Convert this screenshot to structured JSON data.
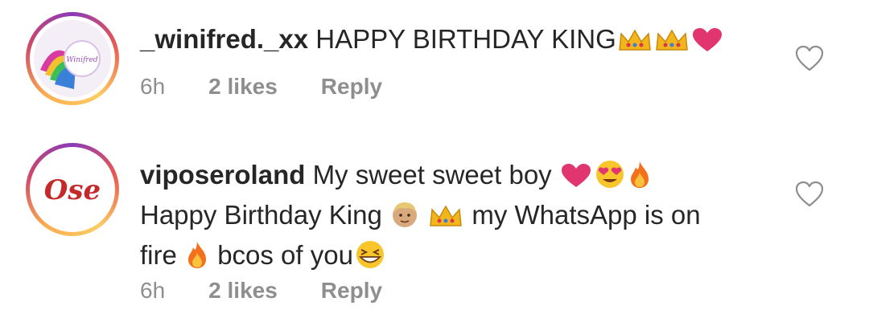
{
  "comments": [
    {
      "username": "_winifred._xx",
      "text": "HAPPY BIRTHDAY KING",
      "time": "6h",
      "likes": "2 likes",
      "reply": "Reply",
      "emojis": [
        "crown",
        "crown",
        "heart"
      ],
      "avatar_text": "Winifred"
    },
    {
      "username": "viposeroland",
      "line1": "My sweet sweet boy",
      "line2a": "Happy Birthday King",
      "line2b": "my WhatsApp is on",
      "line3a": "fire",
      "line3b": "bcos of you",
      "time": "6h",
      "likes": "2 likes",
      "reply": "Reply",
      "avatar_text": "Ose"
    }
  ],
  "colors": {
    "text": "#262626",
    "meta": "#8e8e8e",
    "heart_emoji": "#e0356e",
    "crown": "#f2b51c",
    "fire": "#f4711c"
  }
}
